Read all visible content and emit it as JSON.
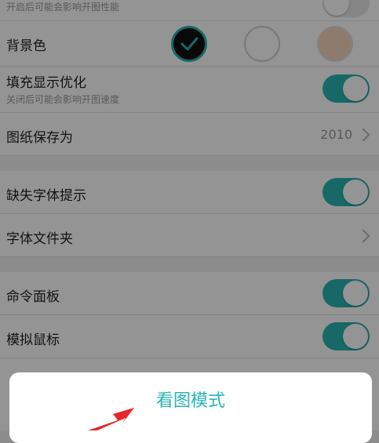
{
  "settings": {
    "top_row": {
      "sublabel": "开启后可能会影响开图性能"
    },
    "background_color": {
      "label": "背景色"
    },
    "fill_display": {
      "label": "填充显示优化",
      "sublabel": "关闭后可能会影响开图速度"
    },
    "save_as": {
      "label": "图纸保存为",
      "value": "2010"
    },
    "missing_font_hint": {
      "label": "缺失字体提示"
    },
    "font_folder": {
      "label": "字体文件夹"
    },
    "command_panel": {
      "label": "命令面板"
    },
    "simulate_mouse": {
      "label": "模拟鼠标"
    }
  },
  "action_sheet": {
    "option_label": "看图模式"
  },
  "colors": {
    "accent": "#2ab3b4",
    "swatch_black": "#111111",
    "swatch_white": "#ffffff",
    "swatch_beige": "#f3d6be",
    "arrow_red": "#e8262c"
  }
}
